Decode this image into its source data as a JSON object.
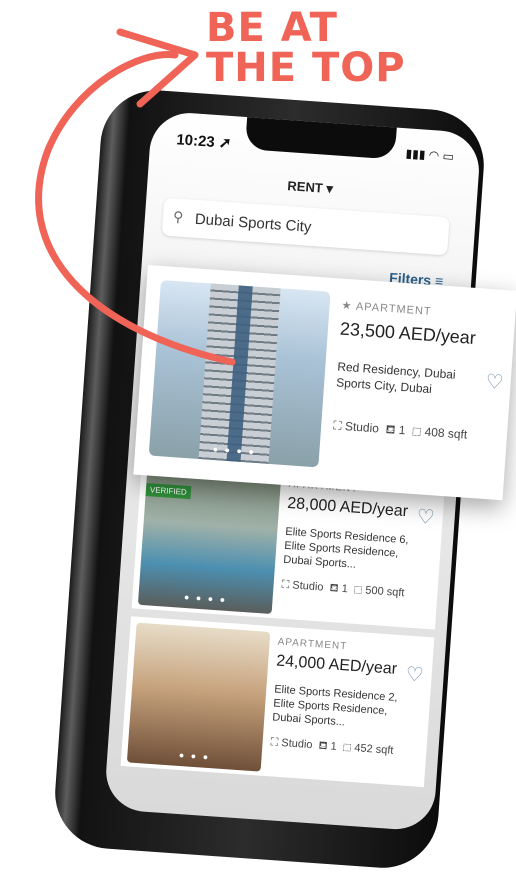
{
  "headline": {
    "line1": "BE AT",
    "line2": "THE TOP"
  },
  "status": {
    "time": "10:23"
  },
  "header": {
    "mode": "RENT ▾"
  },
  "search": {
    "value": "Dubai Sports City"
  },
  "filters_label": "Filters",
  "featured": {
    "type": "APARTMENT",
    "price": "23,500 AED/year",
    "address": "Red Residency, Dubai Sports City, Dubai",
    "beds": "Studio",
    "baths": "1",
    "area": "408 sqft"
  },
  "listings": [
    {
      "type": "APARTMENT",
      "price": "28,000 AED/year",
      "address": "Elite Sports Residence 6, Elite Sports Residence, Dubai Sports...",
      "beds": "Studio",
      "baths": "1",
      "area": "500 sqft",
      "badge": "VERIFIED"
    },
    {
      "type": "APARTMENT",
      "price": "24,000 AED/year",
      "address": "Elite Sports Residence 2, Elite Sports Residence, Dubai Sports...",
      "beds": "Studio",
      "baths": "1",
      "area": "452 sqft"
    }
  ],
  "colors": {
    "accent": "#ef6457",
    "link": "#2a5f8a"
  }
}
